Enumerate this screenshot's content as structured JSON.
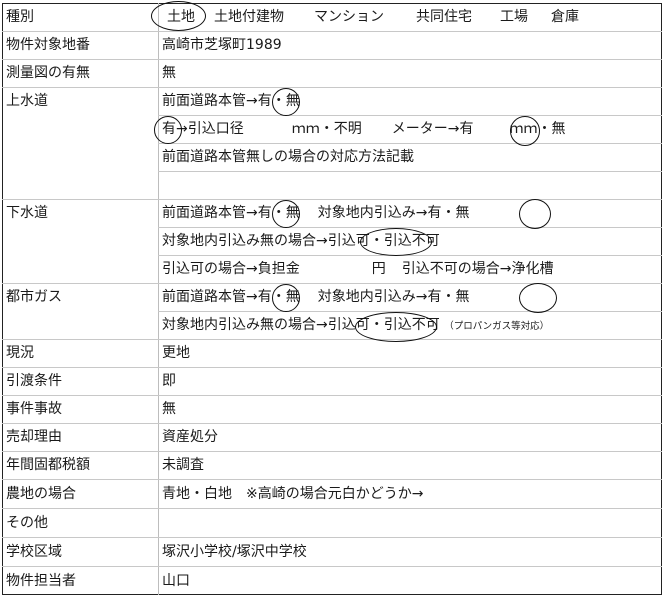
{
  "rows": {
    "type": {
      "label": "種別",
      "selected": "土地",
      "options": [
        "土地付建物",
        "マンション",
        "共同住宅",
        "工場",
        "倉庫"
      ]
    },
    "lot": {
      "label": "物件対象地番",
      "value": "高崎市芝塚町1989"
    },
    "survey": {
      "label": "測量図の有無",
      "value": "無"
    },
    "water": {
      "label": "上水道",
      "line1": {
        "main": "前面道路本管",
        "arrow": "→",
        "yes": "有",
        "dot": "・",
        "no": "無"
      },
      "line2": {
        "yes": "有",
        "rest": "→引込口径",
        "unit1": "ｍｍ・不明",
        "meter": "メーター",
        "arrow": "→",
        "meter_yes": "有",
        "unit2": "ｍｍ・無"
      },
      "line3": "前面道路本管無しの場合の対応方法記載"
    },
    "sewer": {
      "label": "下水道",
      "line1": {
        "main": "前面道路本管",
        "arrow": "→",
        "yes": "有",
        "dot": "・",
        "no": "無",
        "inside": "対象地内引込み→有・",
        "inside_no": "無"
      },
      "line2": {
        "main": "対象地内引込み無の場合",
        "arrow": "→",
        "ok": "引込可",
        "dot": "・",
        "ng": "引込不可"
      },
      "line3": {
        "burden": "引込可の場合→負担金",
        "yen": "円",
        "ng_case": "引込不可の場合→浄化槽"
      }
    },
    "gas": {
      "label": "都市ガス",
      "line1": {
        "main": "前面道路本管",
        "arrow": "→",
        "yes": "有",
        "dot": "・",
        "no": "無",
        "inside": "対象地内引込み→有・",
        "inside_no": "無"
      },
      "line2": {
        "main": "対象地内引込み無の場合",
        "arrow": "→",
        "ok": "引込可",
        "dot": "・",
        "ng": "引込不可",
        "note": "（プロパンガス等対応）"
      }
    },
    "status": {
      "label": "現況",
      "value": "更地"
    },
    "delivery": {
      "label": "引渡条件",
      "value": "即"
    },
    "incident": {
      "label": "事件事故",
      "value": "無"
    },
    "reason": {
      "label": "売却理由",
      "value": "資産処分"
    },
    "tax": {
      "label": "年間固都税額",
      "value": "未調査"
    },
    "farmland": {
      "label": "農地の場合",
      "value": "青地・白地　※高崎の場合元白かどうか→"
    },
    "other": {
      "label": "その他",
      "value": ""
    },
    "school": {
      "label": "学校区域",
      "value": "塚沢小学校/塚沢中学校"
    },
    "agent": {
      "label": "物件担当者",
      "value": "山口"
    }
  }
}
